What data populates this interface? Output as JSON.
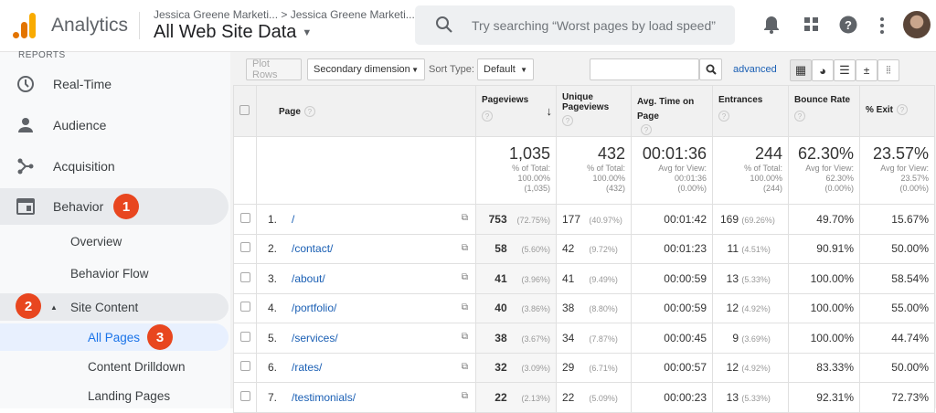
{
  "header": {
    "app_name": "Analytics",
    "breadcrumb": [
      "Jessica Greene Marketi...",
      "Jessica Greene Marketi..."
    ],
    "property": "All Web Site Data",
    "search_placeholder": "Try searching “Worst pages by load speed”"
  },
  "sidebar": {
    "section": "REPORTS",
    "items": [
      {
        "label": "Real-Time",
        "icon": "clock-icon"
      },
      {
        "label": "Audience",
        "icon": "person-icon"
      },
      {
        "label": "Acquisition",
        "icon": "acquisition-icon"
      },
      {
        "label": "Behavior",
        "icon": "behavior-icon"
      }
    ],
    "behavior_sub": [
      "Overview",
      "Behavior Flow"
    ],
    "site_content": "Site Content",
    "site_content_sub": [
      "All Pages",
      "Content Drilldown",
      "Landing Pages"
    ],
    "badges": [
      "1",
      "2",
      "3"
    ],
    "badge_color": "#e8461f"
  },
  "toolbar": {
    "plot_rows": "Plot Rows",
    "secondary_dimension": "Secondary dimension",
    "sort_type_label": "Sort Type:",
    "sort_type_value": "Default",
    "search_value": "",
    "advanced": "advanced"
  },
  "table": {
    "columns": [
      "Page",
      "Pageviews",
      "Unique Pageviews",
      "Avg. Time on Page",
      "Entrances",
      "Bounce Rate",
      "% Exit"
    ],
    "totals": [
      {
        "value": "1,035",
        "l1": "% of Total:",
        "l2": "100.00%",
        "l3": "(1,035)"
      },
      {
        "value": "432",
        "l1": "% of Total:",
        "l2": "100.00%",
        "l3": "(432)"
      },
      {
        "value": "00:01:36",
        "l1": "Avg for View:",
        "l2": "00:01:36",
        "l3": "(0.00%)"
      },
      {
        "value": "244",
        "l1": "% of Total:",
        "l2": "100.00%",
        "l3": "(244)"
      },
      {
        "value": "62.30%",
        "l1": "Avg for View:",
        "l2": "62.30%",
        "l3": "(0.00%)"
      },
      {
        "value": "23.57%",
        "l1": "Avg for View:",
        "l2": "23.57%",
        "l3": "(0.00%)"
      }
    ],
    "rows": [
      {
        "n": "1.",
        "page": "/",
        "pv": "753",
        "pvp": "(72.75%)",
        "upv": "177",
        "upvp": "(40.97%)",
        "time": "00:01:42",
        "ent": "169",
        "entp": "(69.26%)",
        "bounce": "49.70%",
        "exit": "15.67%"
      },
      {
        "n": "2.",
        "page": "/contact/",
        "pv": "58",
        "pvp": "(5.60%)",
        "upv": "42",
        "upvp": "(9.72%)",
        "time": "00:01:23",
        "ent": "11",
        "entp": "(4.51%)",
        "bounce": "90.91%",
        "exit": "50.00%"
      },
      {
        "n": "3.",
        "page": "/about/",
        "pv": "41",
        "pvp": "(3.96%)",
        "upv": "41",
        "upvp": "(9.49%)",
        "time": "00:00:59",
        "ent": "13",
        "entp": "(5.33%)",
        "bounce": "100.00%",
        "exit": "58.54%"
      },
      {
        "n": "4.",
        "page": "/portfolio/",
        "pv": "40",
        "pvp": "(3.86%)",
        "upv": "38",
        "upvp": "(8.80%)",
        "time": "00:00:59",
        "ent": "12",
        "entp": "(4.92%)",
        "bounce": "100.00%",
        "exit": "55.00%"
      },
      {
        "n": "5.",
        "page": "/services/",
        "pv": "38",
        "pvp": "(3.67%)",
        "upv": "34",
        "upvp": "(7.87%)",
        "time": "00:00:45",
        "ent": "9",
        "entp": "(3.69%)",
        "bounce": "100.00%",
        "exit": "44.74%"
      },
      {
        "n": "6.",
        "page": "/rates/",
        "pv": "32",
        "pvp": "(3.09%)",
        "upv": "29",
        "upvp": "(6.71%)",
        "time": "00:00:57",
        "ent": "12",
        "entp": "(4.92%)",
        "bounce": "83.33%",
        "exit": "50.00%"
      },
      {
        "n": "7.",
        "page": "/testimonials/",
        "pv": "22",
        "pvp": "(2.13%)",
        "upv": "22",
        "upvp": "(5.09%)",
        "time": "00:00:23",
        "ent": "13",
        "entp": "(5.33%)",
        "bounce": "92.31%",
        "exit": "72.73%"
      }
    ]
  }
}
